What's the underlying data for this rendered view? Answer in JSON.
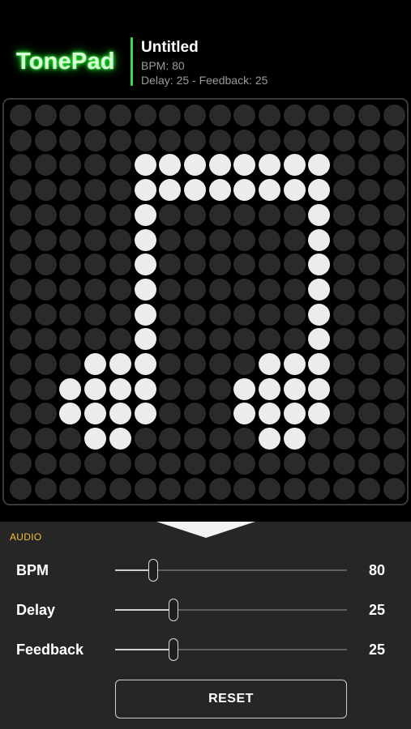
{
  "app": {
    "logo": "TonePad"
  },
  "song": {
    "title": "Untitled",
    "bpm_line": "BPM: 80",
    "delay_line": "Delay: 25 - Feedback: 25"
  },
  "grid": {
    "rows": 16,
    "cols": 16,
    "pattern": [
      "0000000000000000",
      "0000000000000000",
      "0000011111111000",
      "0000011111111000",
      "0000010000001000",
      "0000010000001000",
      "0000010000001000",
      "0000010000001000",
      "0000010000001000",
      "0000010000001000",
      "0001110000111000",
      "0011110001111000",
      "0011110001111000",
      "0001100000110000",
      "0000000000000000",
      "0000000000000000"
    ]
  },
  "panel": {
    "section_label": "AUDIO",
    "controls": [
      {
        "label": "BPM",
        "value": "80",
        "level": 0.165
      },
      {
        "label": "Delay",
        "value": "25",
        "level": 0.25
      },
      {
        "label": "Feedback",
        "value": "25",
        "level": 0.25
      }
    ],
    "reset_label": "RESET"
  },
  "colors": {
    "accent_green": "#3fd84a",
    "section_yellow": "#f1c232",
    "cell_on": "#ececec",
    "cell_off": "#2a2a2a"
  }
}
